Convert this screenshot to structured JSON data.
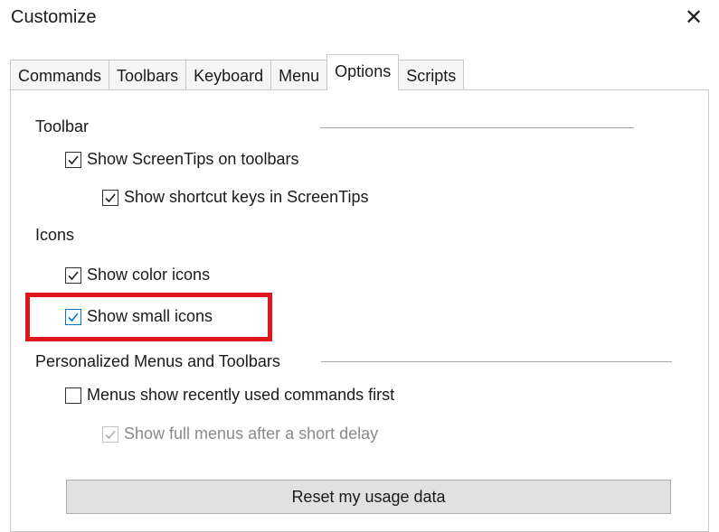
{
  "window": {
    "title": "Customize",
    "close_symbol": "✕"
  },
  "tabs": [
    {
      "label": "Commands",
      "active": false
    },
    {
      "label": "Toolbars",
      "active": false
    },
    {
      "label": "Keyboard",
      "active": false
    },
    {
      "label": "Menu",
      "active": false
    },
    {
      "label": "Options",
      "active": true
    },
    {
      "label": "Scripts",
      "active": false
    }
  ],
  "options": {
    "toolbar_group": {
      "label": "Toolbar",
      "show_screentips": {
        "label": "Show ScreenTips on toolbars",
        "checked": true
      },
      "show_shortcut_keys": {
        "label": "Show shortcut keys in ScreenTips",
        "checked": true
      }
    },
    "icons_group": {
      "label": "Icons",
      "show_color_icons": {
        "label": "Show color icons",
        "checked": true
      },
      "show_small_icons": {
        "label": "Show small icons",
        "checked": true
      }
    },
    "personalized_group": {
      "label": "Personalized Menus and Toolbars",
      "recent_commands_first": {
        "label": "Menus show recently used commands first",
        "checked": false
      },
      "full_menus_delay": {
        "label": "Show full menus after a short delay",
        "checked": true,
        "disabled": true
      }
    },
    "reset_button": "Reset my usage data"
  },
  "colors": {
    "highlight": "#e0151d",
    "focus": "#0078d7"
  }
}
